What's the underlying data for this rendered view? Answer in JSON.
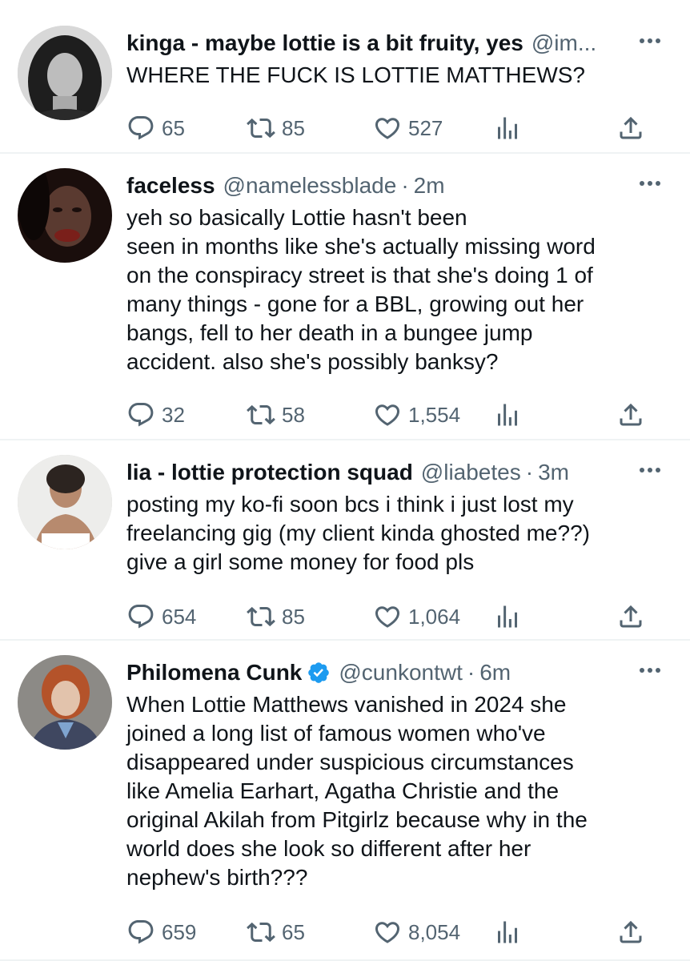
{
  "tweets": [
    {
      "name": "kinga - maybe lottie is a bit fruity, yes",
      "handle": "@im...",
      "time": "",
      "verified": false,
      "text_lines": [
        "WHERE THE FUCK IS LOTTIE MATTHEWS?"
      ],
      "replies": "65",
      "retweets": "85",
      "likes": "527"
    },
    {
      "name": "faceless",
      "handle": "@namelessblade",
      "time": "2m",
      "verified": false,
      "text_lines": [
        "yeh so basically Lottie hasn't been",
        "seen in months like she's actually missing word",
        "on the conspiracy street is that she's doing 1 of",
        "many things - gone for a BBL, growing out her",
        "bangs, fell to her death in a bungee jump",
        "accident. also she's possibly banksy?"
      ],
      "replies": "32",
      "retweets": "58",
      "likes": "1,554"
    },
    {
      "name": "lia - lottie protection squad",
      "handle": "@liabetes",
      "time": "3m",
      "verified": false,
      "text_lines": [
        "posting my ko-fi soon bcs i think i just lost my",
        "freelancing gig (my client kinda ghosted me??)",
        "give a girl some money for food pls"
      ],
      "replies": "654",
      "retweets": "85",
      "likes": "1,064"
    },
    {
      "name": "Philomena Cunk",
      "handle": "@cunkontwt",
      "time": "6m",
      "verified": true,
      "text_lines": [
        "When Lottie Matthews vanished in 2024 she",
        "joined a long list of famous women who've",
        "disappeared under suspicious circumstances",
        "like Amelia Earhart, Agatha Christie and the",
        "original Akilah from Pitgirlz because why in the",
        "world does she look so different after her",
        "nephew's birth???"
      ],
      "replies": "659",
      "retweets": "65",
      "likes": "8,054"
    }
  ],
  "colors": {
    "text": "#0f1419",
    "secondary": "#536471",
    "divider": "#eff3f4",
    "verified": "#1d9bf0"
  },
  "icons": [
    "reply-icon",
    "retweet-icon",
    "like-icon",
    "views-icon",
    "share-icon",
    "more-icon",
    "verified-icon"
  ]
}
